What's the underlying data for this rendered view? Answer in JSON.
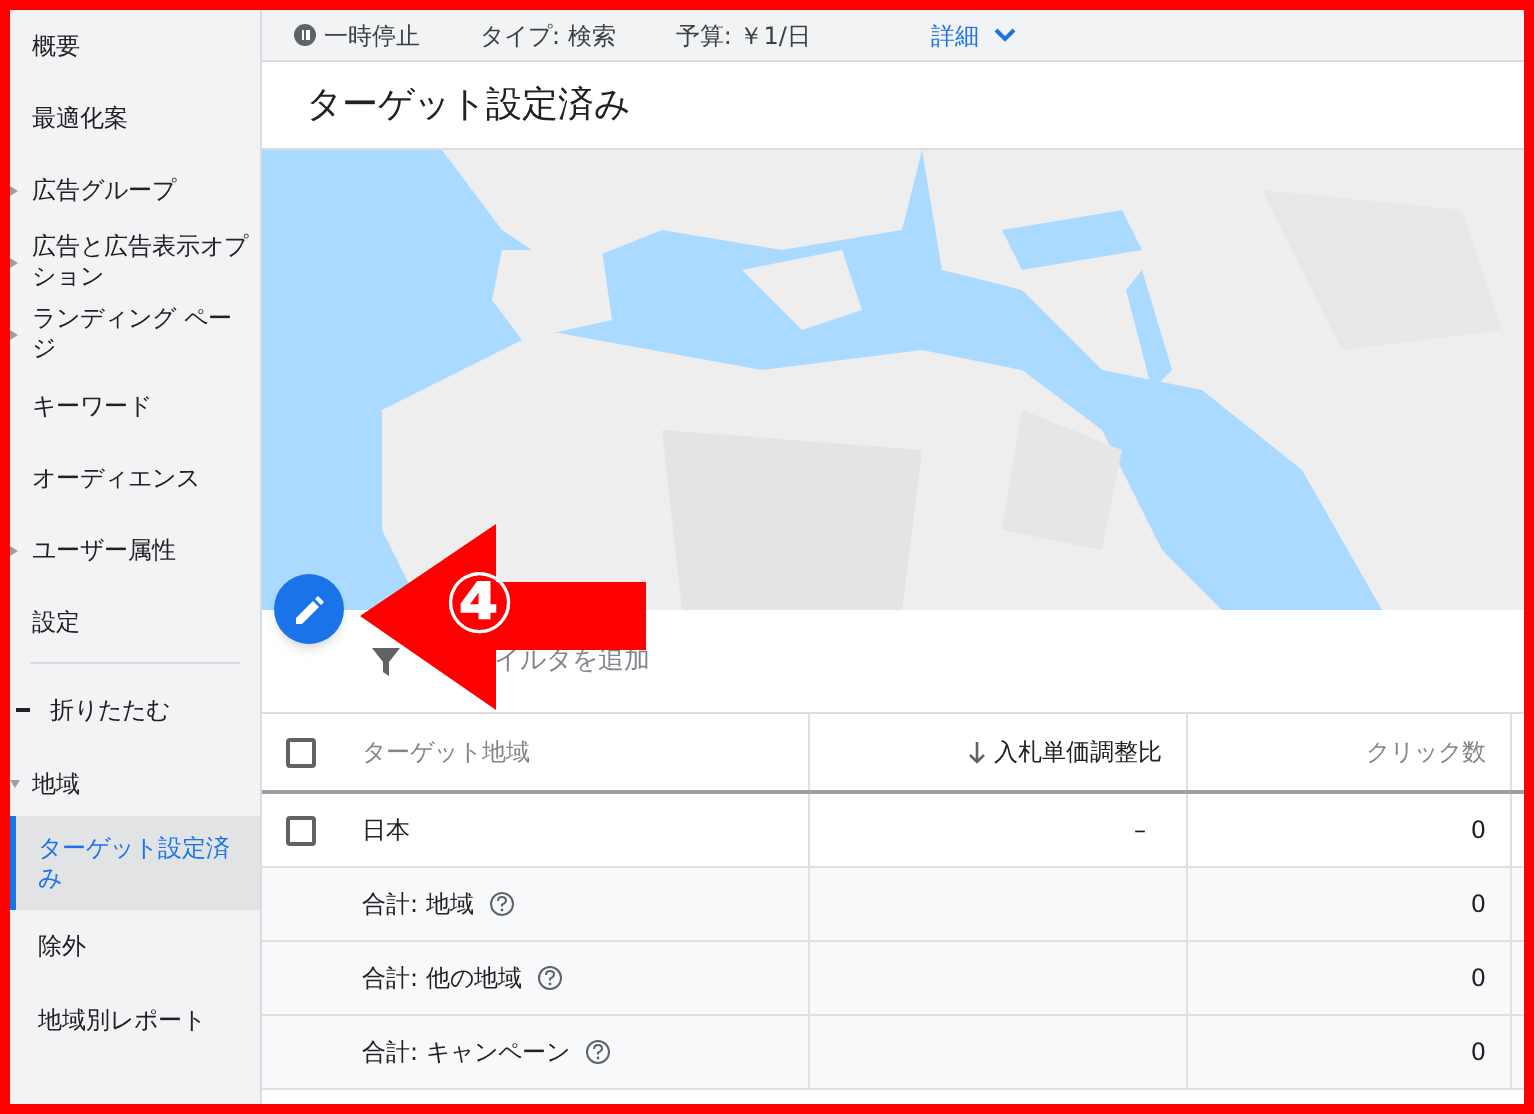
{
  "sidebar": {
    "items": [
      {
        "label": "概要",
        "expandable": false,
        "selected": false
      },
      {
        "label": "最適化案",
        "expandable": false,
        "selected": false
      },
      {
        "label": "広告グループ",
        "expandable": true,
        "selected": false
      },
      {
        "label": "広告と広告表示オプション",
        "expandable": true,
        "selected": false
      },
      {
        "label": "ランディング ページ",
        "expandable": true,
        "selected": false
      },
      {
        "label": "キーワード",
        "expandable": false,
        "selected": false
      },
      {
        "label": "オーディエンス",
        "expandable": false,
        "selected": false
      },
      {
        "label": "ユーザー属性",
        "expandable": true,
        "selected": false
      },
      {
        "label": "設定",
        "expandable": false,
        "selected": false
      }
    ],
    "collapse": "折りたたむ",
    "section": {
      "label": "地域",
      "expanded": true,
      "children": [
        {
          "label": "ターゲット設定済み",
          "selected": true
        },
        {
          "label": "除外",
          "selected": false
        },
        {
          "label": "地域別レポート",
          "selected": false
        }
      ]
    }
  },
  "status_bar": {
    "status": "一時停止",
    "type": "タイプ: 検索",
    "budget": "予算: ￥1/日",
    "details": "詳細"
  },
  "page_title": "ターゲット設定済み",
  "filter": {
    "placeholder": "イルタを追加"
  },
  "annotation": {
    "label": "④"
  },
  "table": {
    "select_all_checked": false,
    "columns": [
      {
        "label": "ターゲット地域",
        "sorted": false
      },
      {
        "label": "入札単価調整比",
        "sorted": true
      },
      {
        "label": "クリック数",
        "sorted": false
      }
    ],
    "rows": [
      {
        "kind": "item",
        "checked": false,
        "name": "日本",
        "bid": "–",
        "clicks": "0"
      },
      {
        "kind": "total",
        "name": "合計: 地域",
        "clicks": "0"
      },
      {
        "kind": "total",
        "name": "合計: 他の地域",
        "clicks": "0"
      },
      {
        "kind": "total",
        "name": "合計: キャンペーン",
        "clicks": "0"
      }
    ]
  }
}
